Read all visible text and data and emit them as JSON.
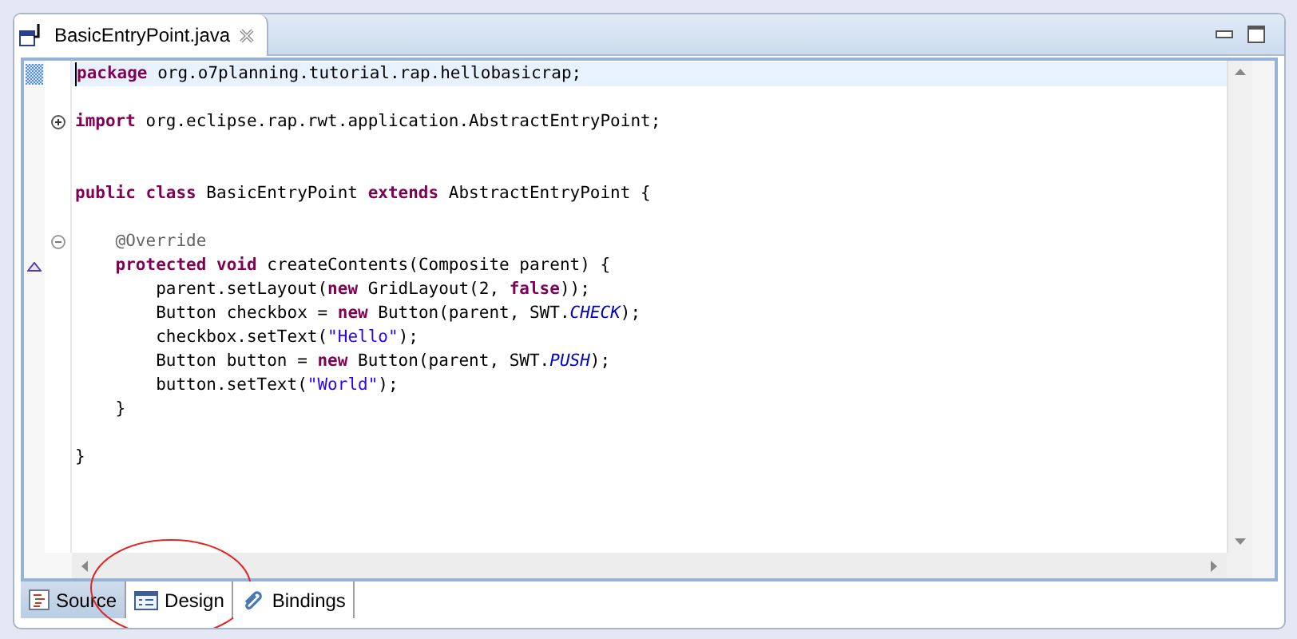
{
  "editor_tab": {
    "title": "BasicEntryPoint.java"
  },
  "code_lines": [
    {
      "current": true,
      "override": false,
      "tokens": [
        {
          "kind": "keyword",
          "text": "package"
        },
        {
          "kind": "plain",
          "text": " org.o7planning.tutorial.rap.hellobasicrap;"
        }
      ]
    },
    {
      "current": false,
      "override": false
    },
    {
      "current": false,
      "override": false,
      "fold": {
        "expanded": false
      },
      "tokens": [
        {
          "kind": "keyword",
          "text": "import"
        },
        {
          "kind": "plain",
          "text": " org.eclipse.rap.rwt.application.AbstractEntryPoint;"
        }
      ]
    },
    {
      "current": false,
      "override": false
    },
    {
      "current": false,
      "override": false
    },
    {
      "current": false,
      "override": false,
      "tokens": [
        {
          "kind": "keyword",
          "text": "public class"
        },
        {
          "kind": "plain",
          "text": " BasicEntryPoint "
        },
        {
          "kind": "keyword",
          "text": "extends"
        },
        {
          "kind": "plain",
          "text": " AbstractEntryPoint {"
        }
      ]
    },
    {
      "current": false,
      "override": false
    },
    {
      "current": false,
      "override": false,
      "fold": {
        "expanded": true
      },
      "tokens": [
        {
          "kind": "annotation",
          "text": "    @Override"
        }
      ]
    },
    {
      "current": false,
      "override": true,
      "tokens": [
        {
          "kind": "keyword",
          "text": "    protected void"
        },
        {
          "kind": "plain",
          "text": " createContents(Composite parent) {"
        }
      ]
    },
    {
      "current": false,
      "override": false,
      "tokens": [
        {
          "kind": "plain",
          "text": "        parent.setLayout("
        },
        {
          "kind": "keyword",
          "text": "new"
        },
        {
          "kind": "plain",
          "text": " GridLayout(2, "
        },
        {
          "kind": "keyword",
          "text": "false"
        },
        {
          "kind": "plain",
          "text": "));"
        }
      ]
    },
    {
      "current": false,
      "override": false,
      "tokens": [
        {
          "kind": "plain",
          "text": "        Button checkbox = "
        },
        {
          "kind": "keyword",
          "text": "new"
        },
        {
          "kind": "plain",
          "text": " Button(parent, SWT."
        },
        {
          "kind": "constant",
          "text": "CHECK"
        },
        {
          "kind": "plain",
          "text": ");"
        }
      ]
    },
    {
      "current": false,
      "override": false,
      "tokens": [
        {
          "kind": "plain",
          "text": "        checkbox.setText("
        },
        {
          "kind": "string",
          "text": "\"Hello\""
        },
        {
          "kind": "plain",
          "text": ");"
        }
      ]
    },
    {
      "current": false,
      "override": false,
      "tokens": [
        {
          "kind": "plain",
          "text": "        Button button = "
        },
        {
          "kind": "keyword",
          "text": "new"
        },
        {
          "kind": "plain",
          "text": " Button(parent, SWT."
        },
        {
          "kind": "constant",
          "text": "PUSH"
        },
        {
          "kind": "plain",
          "text": ");"
        }
      ]
    },
    {
      "current": false,
      "override": false,
      "tokens": [
        {
          "kind": "plain",
          "text": "        button.setText("
        },
        {
          "kind": "string",
          "text": "\"World\""
        },
        {
          "kind": "plain",
          "text": ");"
        }
      ]
    },
    {
      "current": false,
      "override": false,
      "tokens": [
        {
          "kind": "plain",
          "text": "    }"
        }
      ]
    },
    {
      "current": false,
      "override": false
    },
    {
      "current": false,
      "override": false,
      "tokens": [
        {
          "kind": "plain",
          "text": "}"
        }
      ]
    }
  ],
  "bottom_tabs": [
    {
      "label": "Source",
      "selected": true,
      "circled": false
    },
    {
      "label": "Design",
      "selected": false,
      "circled": true
    },
    {
      "label": "Bindings",
      "selected": false,
      "circled": false
    }
  ]
}
